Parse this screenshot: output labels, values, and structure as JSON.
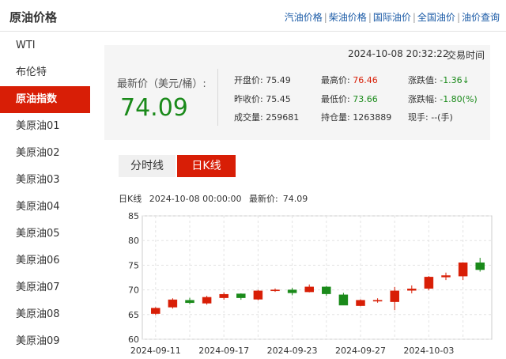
{
  "header": {
    "title": "原油价格",
    "links": [
      "汽油价格",
      "柴油价格",
      "国际油价",
      "全国油价",
      "油价查询"
    ]
  },
  "sidebar": {
    "items": [
      "WTI",
      "布伦特",
      "原油指数",
      "美原油01",
      "美原油02",
      "美原油03",
      "美原油04",
      "美原油05",
      "美原油06",
      "美原油07",
      "美原油08",
      "美原油09"
    ],
    "active_index": 2
  },
  "quote": {
    "datetime": "2024-10-08 20:32:22",
    "time_label": "交易时间",
    "latest_label": "最新价（美元/桶）:",
    "latest_value": "74.09",
    "open_label": "开盘价:",
    "open_value": "75.49",
    "high_label": "最高价:",
    "high_value": "76.46",
    "change_label": "涨跌值:",
    "change_value": "-1.36↓",
    "prev_close_label": "昨收价:",
    "prev_close_value": "75.45",
    "low_label": "最低价:",
    "low_value": "73.66",
    "change_pct_label": "涨跌幅:",
    "change_pct_value": "-1.80(%)",
    "volume_label": "成交量:",
    "volume_value": "259681",
    "open_interest_label": "持仓量:",
    "open_interest_value": "1263889",
    "hand_label": "现手:",
    "hand_value": "--(手)",
    "up_color": "#d81e06",
    "down_color": "#1a8a1a"
  },
  "tabs": {
    "intraday": "分时线",
    "daily": "日K线",
    "active": "daily"
  },
  "chart_info": {
    "kline_label": "日K线",
    "date": "2024-10-08 00:00:00",
    "latest_label": "最新价:",
    "latest_value": "74.09"
  },
  "chart_data": {
    "type": "candlestick",
    "ylim": [
      60,
      85
    ],
    "y_ticks": [
      60,
      65,
      70,
      75,
      80,
      85
    ],
    "x_tick_labels": [
      "2024-09-11",
      "2024-09-17",
      "2024-09-23",
      "2024-09-27",
      "2024-10-03"
    ],
    "x_tick_indices": [
      0,
      4,
      8,
      12,
      16
    ],
    "grid": true,
    "candles": [
      {
        "open": 65.2,
        "close": 66.3,
        "high": 66.5,
        "low": 64.9
      },
      {
        "open": 66.5,
        "close": 68.0,
        "high": 68.3,
        "low": 66.2
      },
      {
        "open": 67.9,
        "close": 67.4,
        "high": 68.4,
        "low": 67.1
      },
      {
        "open": 67.3,
        "close": 68.5,
        "high": 68.8,
        "low": 67.0
      },
      {
        "open": 68.4,
        "close": 69.1,
        "high": 69.5,
        "low": 68.0
      },
      {
        "open": 69.2,
        "close": 68.4,
        "high": 69.3,
        "low": 68.0
      },
      {
        "open": 68.1,
        "close": 69.8,
        "high": 70.0,
        "low": 67.9
      },
      {
        "open": 70.0,
        "close": 70.0,
        "high": 70.3,
        "low": 69.6
      },
      {
        "open": 70.0,
        "close": 69.4,
        "high": 70.4,
        "low": 68.9
      },
      {
        "open": 69.6,
        "close": 70.6,
        "high": 71.1,
        "low": 69.5
      },
      {
        "open": 70.6,
        "close": 69.2,
        "high": 70.8,
        "low": 68.8
      },
      {
        "open": 69.0,
        "close": 66.9,
        "high": 69.4,
        "low": 66.9
      },
      {
        "open": 66.8,
        "close": 67.9,
        "high": 68.1,
        "low": 66.7
      },
      {
        "open": 67.9,
        "close": 67.9,
        "high": 68.3,
        "low": 67.4
      },
      {
        "open": 67.6,
        "close": 69.8,
        "high": 70.6,
        "low": 65.9
      },
      {
        "open": 69.9,
        "close": 70.2,
        "high": 70.9,
        "low": 69.3
      },
      {
        "open": 70.3,
        "close": 72.6,
        "high": 72.8,
        "low": 69.9
      },
      {
        "open": 72.6,
        "close": 72.9,
        "high": 73.5,
        "low": 72.0
      },
      {
        "open": 72.8,
        "close": 75.5,
        "high": 75.6,
        "low": 72.0
      },
      {
        "open": 75.5,
        "close": 74.1,
        "high": 76.5,
        "low": 73.7
      }
    ]
  }
}
